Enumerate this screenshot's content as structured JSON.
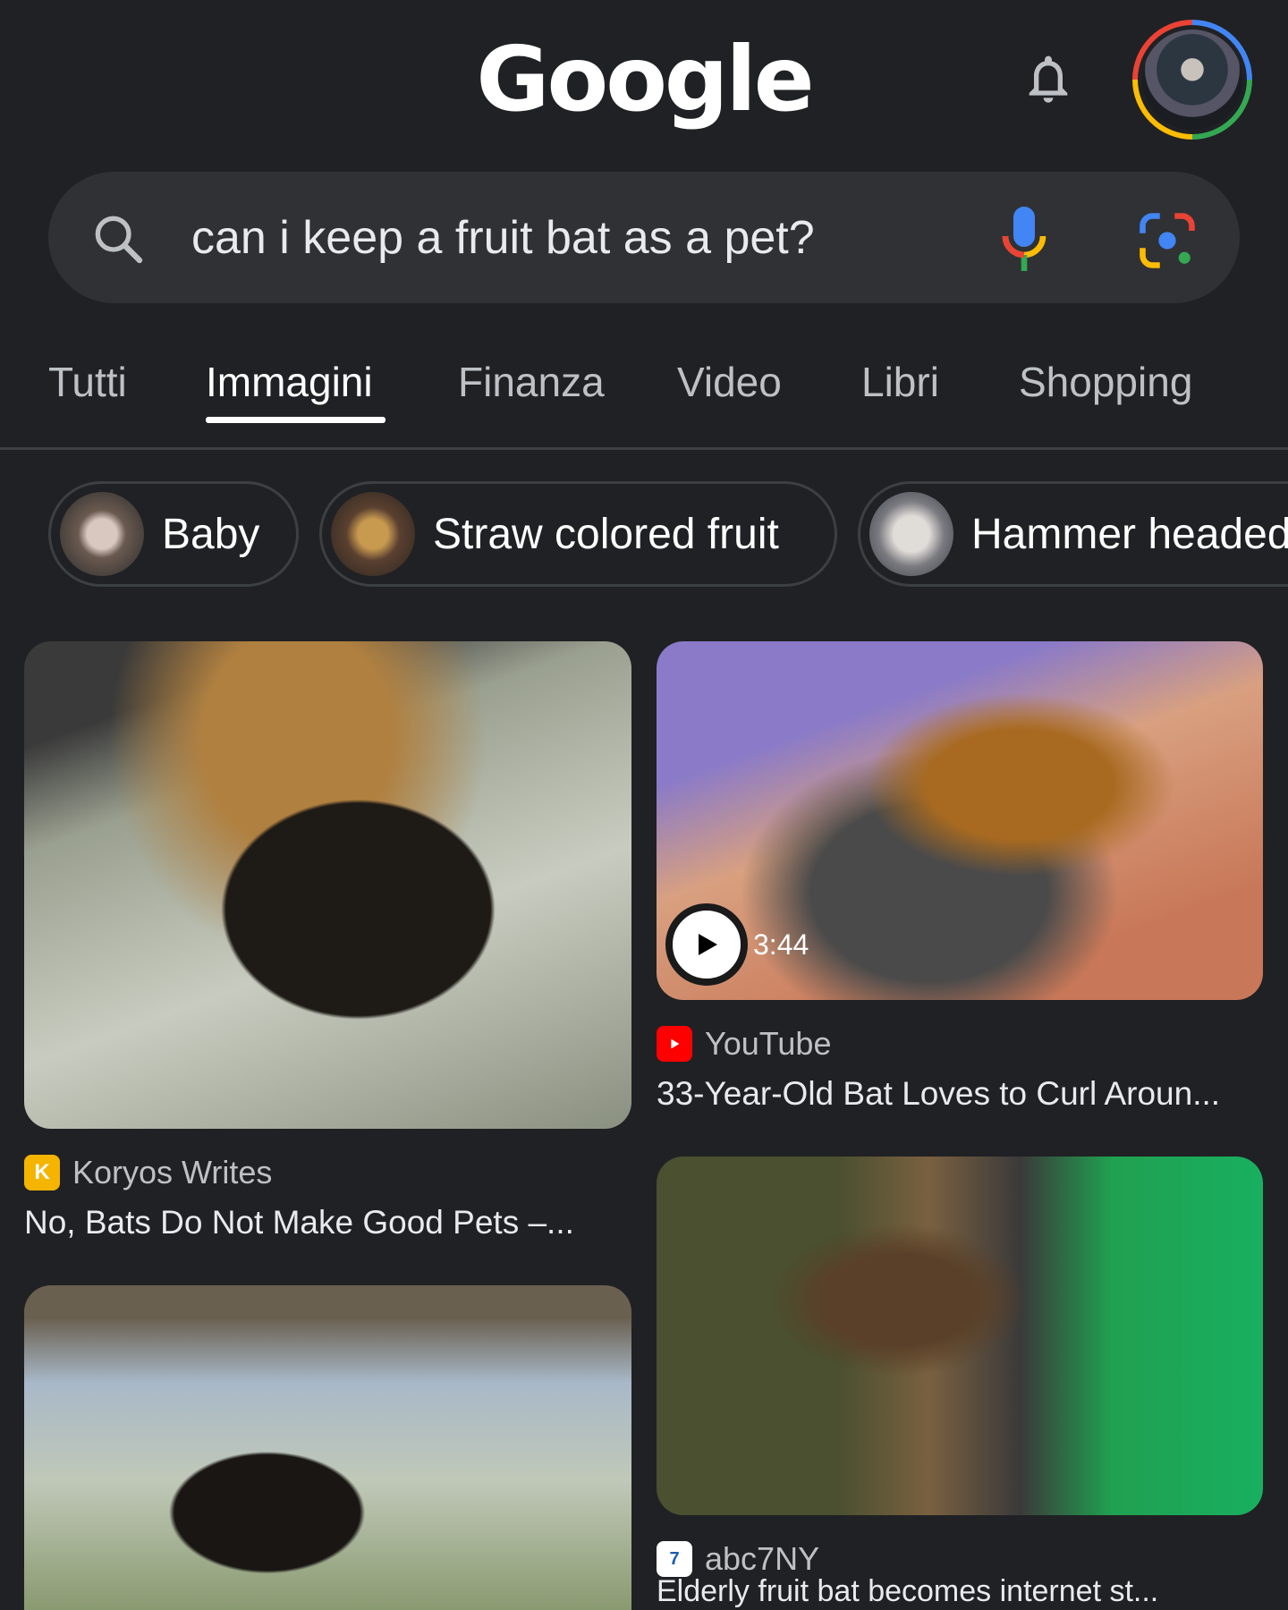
{
  "header": {
    "logo": "Google",
    "notifications_icon": "bell-icon",
    "avatar": "profile-avatar"
  },
  "search": {
    "query": "can i keep a fruit bat as a pet?",
    "icons": [
      "search-icon",
      "mic-icon",
      "lens-icon"
    ]
  },
  "tabs": [
    {
      "label": "Tutti"
    },
    {
      "label": "Immagini",
      "active": true
    },
    {
      "label": "Finanza"
    },
    {
      "label": "Video"
    },
    {
      "label": "Libri"
    },
    {
      "label": "Shopping"
    }
  ],
  "chips": [
    {
      "label": "Baby"
    },
    {
      "label": "Straw colored fruit"
    },
    {
      "label": "Hammer headed"
    }
  ],
  "results": [
    {
      "source": "Koryos Writes",
      "title": "No, Bats Do Not Make Good Pets –..."
    },
    {
      "source": "YouTube",
      "title": "33-Year-Old Bat Loves to Curl Aroun...",
      "duration": "3:44"
    },
    {
      "source": "abc7NY",
      "title": "Elderly fruit bat becomes internet st..."
    },
    {
      "source": "",
      "title": ""
    }
  ],
  "colors": {
    "background": "#202124",
    "search_bg": "#303134",
    "youtube": "#ff0000"
  }
}
